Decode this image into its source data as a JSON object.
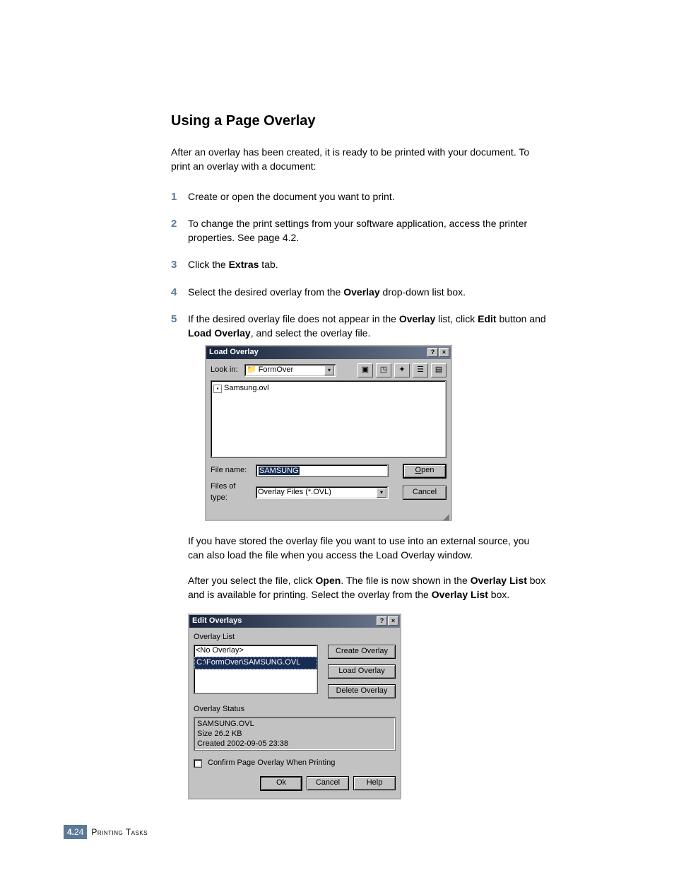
{
  "heading": "Using a Page Overlay",
  "intro": "After an overlay has been created, it is ready to be printed with your document. To print an overlay with a document:",
  "steps": {
    "s1": "Create or open the document you want to print.",
    "s2": "To change the print settings from your software application, access the printer properties. See page 4.2.",
    "s3a": "Click the ",
    "s3b": "Extras",
    "s3c": " tab.",
    "s4a": "Select the desired overlay from the ",
    "s4b": "Overlay",
    "s4c": " drop-down list box.",
    "s5a": "If the desired overlay file does not appear in the ",
    "s5b": "Overlay",
    "s5c": " list, click ",
    "s5d": "Edit",
    "s5e": " button and ",
    "s5f": "Load Overlay",
    "s5g": ", and select the overlay file."
  },
  "dlg1": {
    "title": "Load Overlay",
    "lookin_lbl": "Look in:",
    "lookin_val": "FormOver",
    "file_item": "Samsung.ovl",
    "filename_lbl": "File name:",
    "filename_val": "SAMSUNG",
    "filesoftype_lbl": "Files of type:",
    "filesoftype_val": "Overlay Files (*.OVL)",
    "open_btn": "Open",
    "cancel_btn": "Cancel"
  },
  "para1": "If you have stored the overlay file you want to use into an external source, you can also load the file when you access the Load Overlay window.",
  "para2a": "After you select the file, click ",
  "para2b": "Open",
  "para2c": ". The file is now shown in the ",
  "para2d": "Overlay List",
  "para2e": " box and is available for printing. Select the overlay from the ",
  "para2f": "Overlay List",
  "para2g": " box.",
  "dlg2": {
    "title": "Edit Overlays",
    "list_lbl": "Overlay List",
    "item1": "<No Overlay>",
    "item2": "C:\\FormOver\\SAMSUNG.OVL",
    "create_btn": "Create Overlay",
    "load_btn": "Load Overlay",
    "delete_btn": "Delete Overlay",
    "status_lbl": "Overlay Status",
    "status_line1": "SAMSUNG.OVL",
    "status_line2": "Size 26.2 KB",
    "status_line3": "Created 2002-09-05 23:38",
    "confirm_lbl": "Confirm Page Overlay When Printing",
    "ok_btn": "Ok",
    "cancel_btn": "Cancel",
    "help_btn": "Help"
  },
  "footer": {
    "chapter": "4.",
    "page": "24",
    "section": "Printing Tasks"
  }
}
